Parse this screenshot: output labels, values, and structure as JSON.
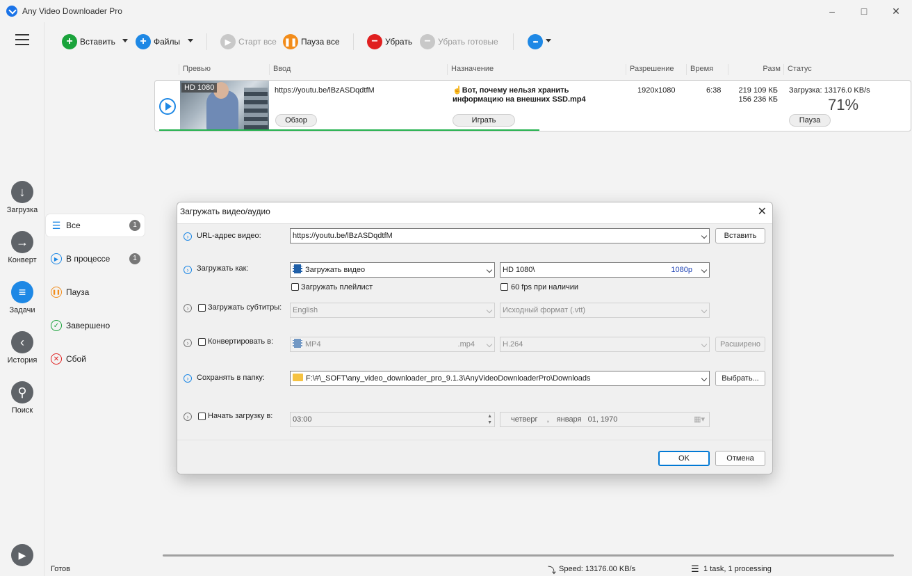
{
  "window": {
    "title": "Any Video Downloader Pro"
  },
  "rail": {
    "items": [
      {
        "label": "Загрузка",
        "icon": "download-icon"
      },
      {
        "label": "Конверт",
        "icon": "convert-arrow-icon"
      },
      {
        "label": "Задачи",
        "icon": "tasks-list-icon"
      },
      {
        "label": "История",
        "icon": "history-back-icon"
      },
      {
        "label": "Поиск",
        "icon": "search-icon"
      }
    ]
  },
  "categories": [
    {
      "label": "Все",
      "badge": "1"
    },
    {
      "label": "В процессе",
      "badge": "1"
    },
    {
      "label": "Пауза"
    },
    {
      "label": "Завершено"
    },
    {
      "label": "Сбой"
    }
  ],
  "toolbar": {
    "paste": "Вставить",
    "files": "Файлы",
    "start_all": "Старт все",
    "pause_all": "Пауза все",
    "remove": "Убрать",
    "remove_done": "Убрать готовые",
    "more_icon": "•••"
  },
  "table": {
    "headers": [
      "Превью",
      "Ввод",
      "Назначение",
      "Разрешение",
      "Время",
      "Разм",
      "Статус"
    ]
  },
  "task": {
    "quality_badge": "HD 1080",
    "url": "https://youtu.be/lBzASDqdtfM",
    "browse": "Обзор",
    "title": "☝️Вот, почему нельзя хранить информацию на внешних SSD.mp4",
    "play": "Играть",
    "resolution": "1920x1080",
    "duration": "6:38",
    "size_done": "219 109 КБ",
    "size_total": "156 236 КБ",
    "status": "Загрузка: 13176.0 KB/s",
    "percent": "71%",
    "progress_fraction": 0.71,
    "pause": "Пауза"
  },
  "statusbar": {
    "ready": "Готов",
    "speed": "Speed: 13176.00 KB/s",
    "tasks": "1 task, 1 processing"
  },
  "dialog": {
    "title": "Загружать видео/аудио",
    "url_label": "URL-адрес видео:",
    "url_value": "https://youtu.be/lBzASDqdtfM",
    "paste": "Вставить",
    "download_as_label": "Загружать как:",
    "download_as_value": "Загружать видео",
    "quality_value": "HD 1080\\",
    "quality_tag": "1080p",
    "playlist": "Загружать плейлист",
    "fps60": "60 fps при наличии",
    "subs_label": "Загружать субтитры:",
    "subs_lang": "English",
    "subs_format": "Исходный формат (.vtt)",
    "convert_label": "Конвертировать в:",
    "convert_format": "MP4",
    "convert_ext": ".mp4",
    "convert_codec": "H.264",
    "advanced": "Расширено",
    "save_label": "Сохранять в папку:",
    "save_path": "F:\\#\\_SOFT\\any_video_downloader_pro_9.1.3\\AnyVideoDownloaderPro\\Downloads",
    "browse": "Выбрать...",
    "schedule_label": "Начать загрузку в:",
    "schedule_time": "03:00",
    "schedule_day": "четверг",
    "schedule_sep": ",",
    "schedule_month": "января",
    "schedule_date": "01, 1970",
    "ok": "OK",
    "cancel": "Отмена"
  }
}
